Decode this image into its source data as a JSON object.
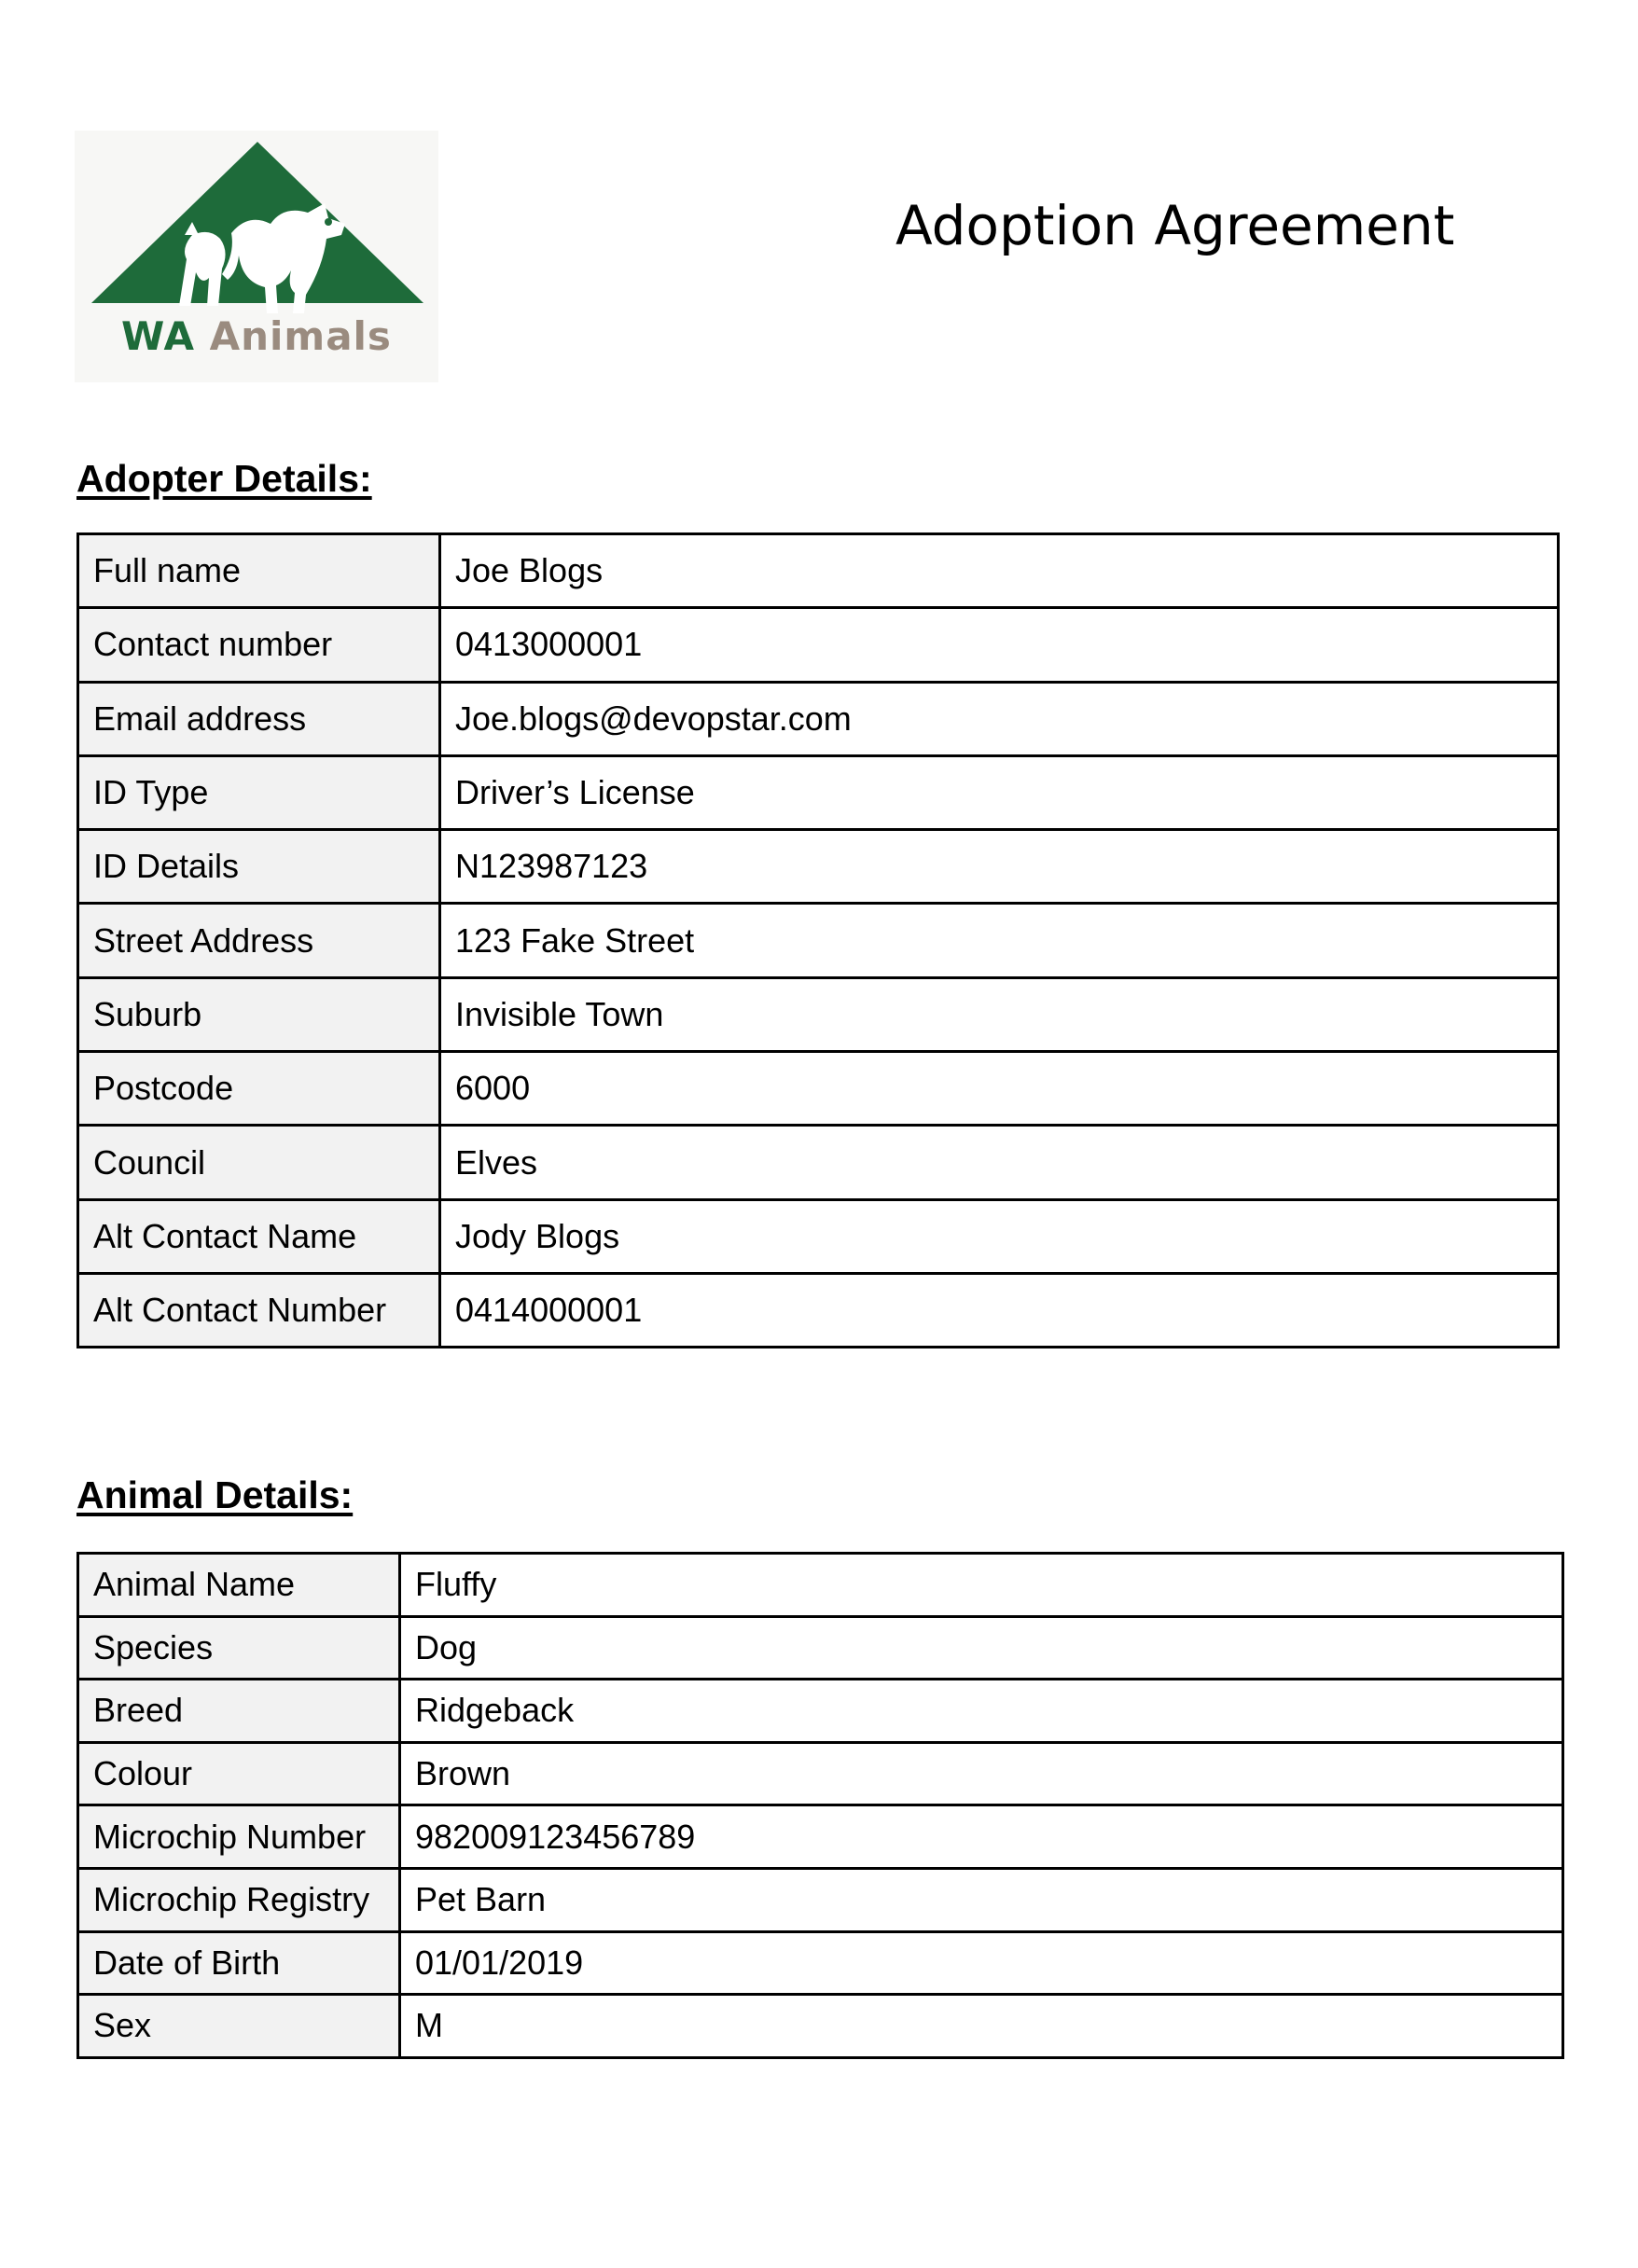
{
  "logo": {
    "brand_wa": "WA",
    "brand_animals": "Animals",
    "colors": {
      "green": "#1e6b3a",
      "taupe": "#9a8b7f"
    }
  },
  "title": "Adoption Agreement",
  "adopter": {
    "heading": "Adopter Details:",
    "rows": [
      {
        "label": "Full name",
        "value": "Joe Blogs"
      },
      {
        "label": "Contact number",
        "value": "0413000001"
      },
      {
        "label": "Email address",
        "value": "Joe.blogs@devopstar.com"
      },
      {
        "label": "ID Type",
        "value": "Driver’s License"
      },
      {
        "label": "ID Details",
        "value": "N123987123"
      },
      {
        "label": "Street Address",
        "value": "123 Fake Street"
      },
      {
        "label": "Suburb",
        "value": "Invisible Town"
      },
      {
        "label": "Postcode",
        "value": "6000"
      },
      {
        "label": "Council",
        "value": "Elves"
      },
      {
        "label": "Alt Contact Name",
        "value": "Jody Blogs"
      },
      {
        "label": "Alt Contact Number",
        "value": "0414000001"
      }
    ]
  },
  "animal": {
    "heading": "Animal Details:",
    "rows": [
      {
        "label": "Animal Name",
        "value": "Fluffy"
      },
      {
        "label": "Species",
        "value": "Dog"
      },
      {
        "label": "Breed",
        "value": "Ridgeback"
      },
      {
        "label": "Colour",
        "value": "Brown"
      },
      {
        "label": "Microchip Number",
        "value": "982009123456789"
      },
      {
        "label": "Microchip Registry",
        "value": "Pet Barn"
      },
      {
        "label": "Date of Birth",
        "value": "01/01/2019"
      },
      {
        "label": "Sex",
        "value": "M"
      }
    ]
  }
}
